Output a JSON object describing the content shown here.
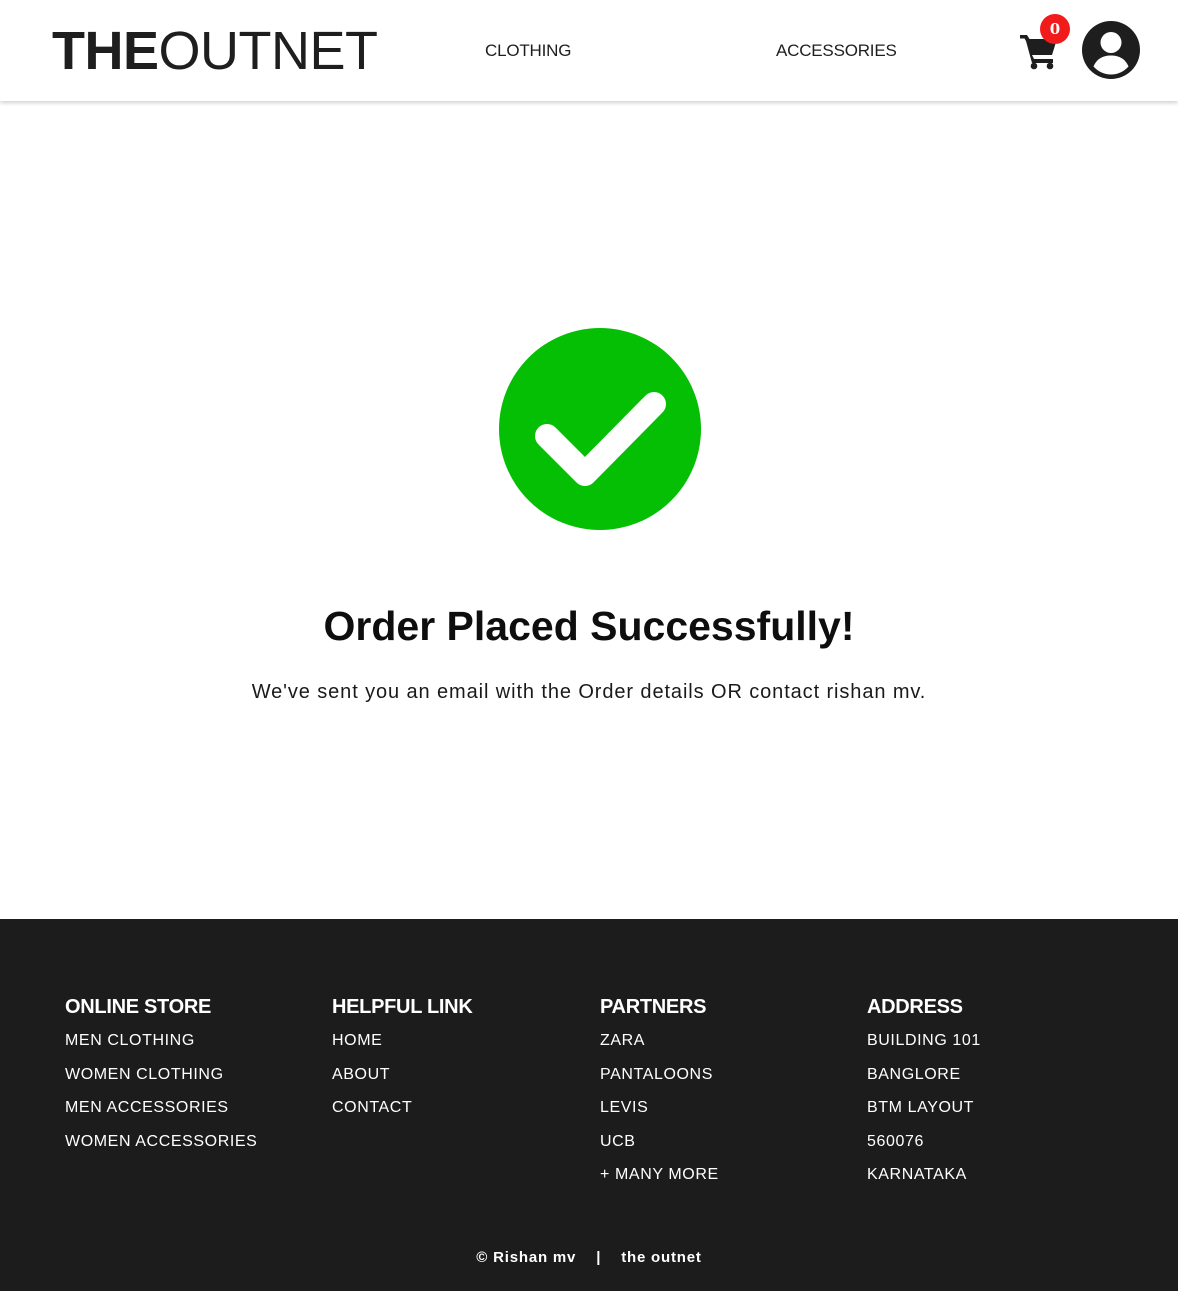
{
  "header": {
    "logo_bold": "THE",
    "logo_light": "OUTNET",
    "nav": [
      {
        "label": "CLOTHING"
      },
      {
        "label": "ACCESSORIES"
      }
    ],
    "cart_count": "0",
    "cart_icon": "shopping-cart-icon",
    "avatar_icon": "user-circle-icon",
    "badge_color": "#f21b1b"
  },
  "main": {
    "success_icon": "check-circle-icon",
    "success_color": "#05bf05",
    "title": "Order Placed Successfully!",
    "message": "We've sent you an email with the Order details OR contact rishan mv."
  },
  "footer": {
    "background": "#1c1c1d",
    "columns": [
      {
        "heading": "ONLINE STORE",
        "items": [
          "MEN CLOTHING",
          "WOMEN CLOTHING",
          "MEN ACCESSORIES",
          "WOMEN ACCESSORIES"
        ]
      },
      {
        "heading": "HELPFUL LINK",
        "items": [
          "HOME",
          "ABOUT",
          "CONTACT"
        ]
      },
      {
        "heading": "PARTNERS",
        "items": [
          "ZARA",
          "PANTALOONS",
          "LEVIS",
          "UCB",
          "+ MANY MORE"
        ]
      },
      {
        "heading": "ADDRESS",
        "items": [
          "BUILDING 101",
          "BANGLORE",
          "BTM LAYOUT",
          "560076",
          "KARNATAKA"
        ]
      }
    ],
    "copyright_left": "© Rishan mv",
    "copyright_sep": "|",
    "copyright_right": "the outnet"
  }
}
